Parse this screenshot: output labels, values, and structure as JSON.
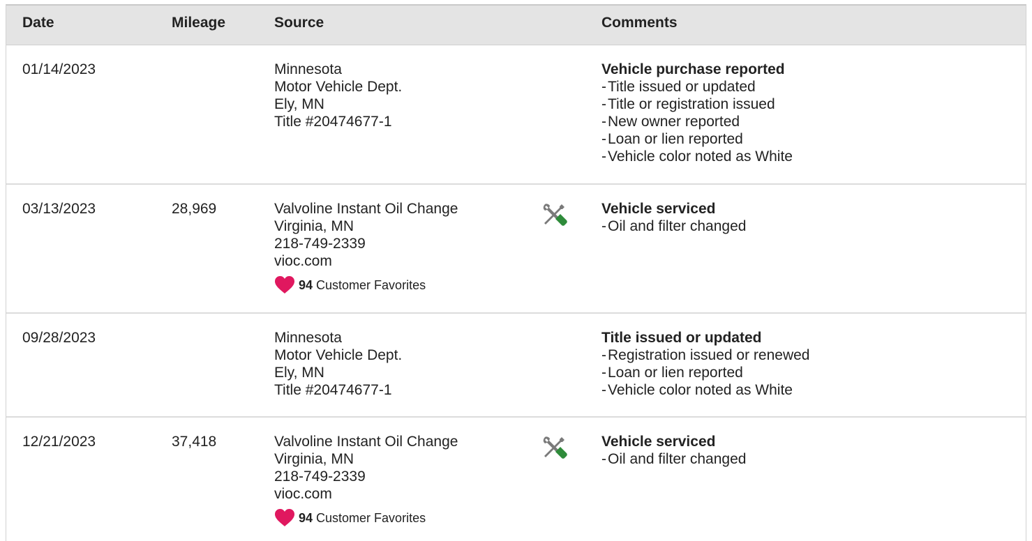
{
  "headers": {
    "date": "Date",
    "mileage": "Mileage",
    "source": "Source",
    "comments": "Comments"
  },
  "colors": {
    "header_bg": "#e4e4e4",
    "heart": "#e0185f",
    "wrench_green": "#2e8b3a",
    "tool_gray": "#7a7a7a"
  },
  "rows": [
    {
      "date": "01/14/2023",
      "mileage": "",
      "source": [
        "Minnesota",
        "Motor Vehicle Dept.",
        "Ely, MN",
        "Title #20474677-1"
      ],
      "icon": "",
      "favorites": null,
      "comment_title": "Vehicle purchase reported",
      "comment_items": [
        "Title issued or updated",
        "Title or registration issued",
        "New owner reported",
        "Loan or lien reported",
        "Vehicle color noted as White"
      ]
    },
    {
      "date": "03/13/2023",
      "mileage": "28,969",
      "source": [
        "Valvoline Instant Oil Change",
        "Virginia, MN",
        "218-749-2339",
        "vioc.com"
      ],
      "icon": "tools-icon",
      "favorites": {
        "count": "94",
        "label": "Customer Favorites"
      },
      "comment_title": "Vehicle serviced",
      "comment_items": [
        "Oil and filter changed"
      ]
    },
    {
      "date": "09/28/2023",
      "mileage": "",
      "source": [
        "Minnesota",
        "Motor Vehicle Dept.",
        "Ely, MN",
        "Title #20474677-1"
      ],
      "icon": "",
      "favorites": null,
      "comment_title": "Title issued or updated",
      "comment_items": [
        "Registration issued or renewed",
        "Loan or lien reported",
        "Vehicle color noted as White"
      ]
    },
    {
      "date": "12/21/2023",
      "mileage": "37,418",
      "source": [
        "Valvoline Instant Oil Change",
        "Virginia, MN",
        "218-749-2339",
        "vioc.com"
      ],
      "icon": "tools-icon",
      "favorites": {
        "count": "94",
        "label": "Customer Favorites"
      },
      "comment_title": "Vehicle serviced",
      "comment_items": [
        "Oil and filter changed"
      ]
    }
  ]
}
